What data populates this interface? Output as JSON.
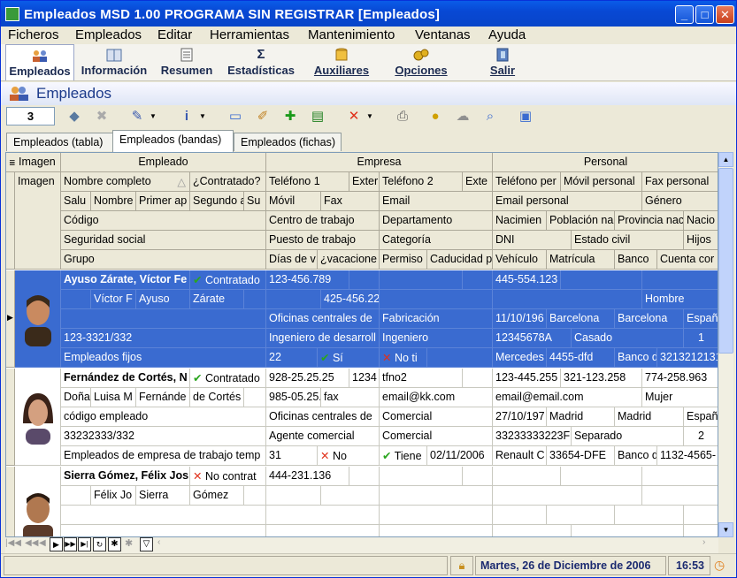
{
  "window": {
    "title": "Empleados MSD 1.00 PROGRAMA SIN REGISTRAR [Empleados]"
  },
  "menu": [
    "Ficheros",
    "Empleados",
    "Editar",
    "Herramientas",
    "Mantenimiento",
    "Ventanas",
    "Ayuda"
  ],
  "nav": [
    "Empleados",
    "Información",
    "Resumen",
    "Estadísticas",
    "Auxiliares",
    "Opciones",
    "Salir"
  ],
  "module_title": "Empleados",
  "record_count": "3",
  "tabs": [
    "Empleados (tabla)",
    "Empleados (bandas)",
    "Empleados (fichas)"
  ],
  "bands": {
    "imagen": "Imagen",
    "empleado": "Empleado",
    "empresa": "Empresa",
    "personal": "Personal"
  },
  "headers": {
    "r1": [
      "Imagen",
      "Nombre completo",
      "¿Contratado?",
      "Teléfono 1",
      "Exter",
      "Teléfono 2",
      "Exte",
      "Teléfono per",
      "Móvil personal",
      "Fax personal"
    ],
    "r2": [
      "Salu",
      "Nombre",
      "Primer ap",
      "Segundo a",
      "Su",
      "Móvil",
      "Fax",
      "Email",
      "Email personal",
      "Género"
    ],
    "r3": [
      "Código",
      "Centro de trabajo",
      "Departamento",
      "Nacimien",
      "Población na",
      "Provincia nac",
      "Nacio"
    ],
    "r4": [
      "Seguridad social",
      "Puesto de trabajo",
      "Categoría",
      "DNI",
      "Estado civil",
      "Hijos"
    ],
    "r5": [
      "Grupo",
      "Días de v",
      "¿vacacione",
      "Permiso",
      "Caducidad p",
      "Vehículo",
      "Matrícula",
      "Banco",
      "Cuenta cor"
    ]
  },
  "records": [
    {
      "nombre_completo": "Ayuso Zárate, Víctor Fe",
      "contratado": "Contratado",
      "telefono1": "123-456.789",
      "telefono_personal": "445-554.123",
      "saludo": "",
      "nombre": "Víctor F",
      "apellido1": "Ayuso",
      "apellido2": "Zárate",
      "fax": "425-456.22",
      "genero": "Hombre",
      "centro": "Oficinas centrales de",
      "departamento": "Fabricación",
      "nacimiento": "11/10/196",
      "poblacion": "Barcelona",
      "provincia": "Barcelona",
      "nacion": "Españ",
      "ss": "123-3321/332",
      "puesto": "Ingeniero de desarroll",
      "categoria": "Ingeniero",
      "dni": "12345678A",
      "estado_civil": "Casado",
      "hijos": "1",
      "grupo": "Empleados fijos",
      "dias": "22",
      "vacaciones": "Sí",
      "permiso": "No ti",
      "vehiculo": "Mercedes",
      "matricula": "4455-dfd",
      "banco": "Banco d",
      "cuenta": "3213212131"
    },
    {
      "nombre_completo": "Fernández de Cortés, N",
      "contratado": "Contratado",
      "telefono1": "928-25.25.25",
      "ext1": "1234",
      "telefono2": "tfno2",
      "telefono_personal": "123-445.255",
      "movil_personal": "321-123.258",
      "fax_personal": "774-258.963",
      "saludo": "Doña",
      "nombre": "Luisa M",
      "apellido1": "Fernánde",
      "apellido2": "de Cortés",
      "movil": "985-05.25.",
      "fax": "fax",
      "email": "email@kk.com",
      "email_personal": "email@email.com",
      "genero": "Mujer",
      "codigo": "código empleado",
      "centro": "Oficinas centrales de",
      "departamento": "Comercial",
      "nacimiento": "27/10/197",
      "poblacion": "Madrid",
      "provincia": "Madrid",
      "nacion": "Españ",
      "ss": "33232333/332",
      "puesto": "Agente comercial",
      "categoria": "Comercial",
      "dni": "33233333223F",
      "estado_civil": "Separado",
      "hijos": "2",
      "grupo": "Empleados de empresa de trabajo temp",
      "dias": "31",
      "vacaciones": "No",
      "permiso": "Tiene",
      "caducidad": "02/11/2006",
      "vehiculo": "Renault C",
      "matricula": "33654-DFE",
      "banco": "Banco d",
      "cuenta": "1132-4565-"
    },
    {
      "nombre_completo": "Sierra Gómez, Félix Jos",
      "contratado": "No contrat",
      "telefono1": "444-231.136",
      "nombre": "Félix Jo",
      "apellido1": "Sierra",
      "apellido2": "Gómez"
    }
  ],
  "status": {
    "date": "Martes, 26 de Diciembre de 2006",
    "time": "16:53"
  },
  "colors": {
    "selection": "#3a6bd0",
    "titlebar": "#0a5ce8"
  }
}
